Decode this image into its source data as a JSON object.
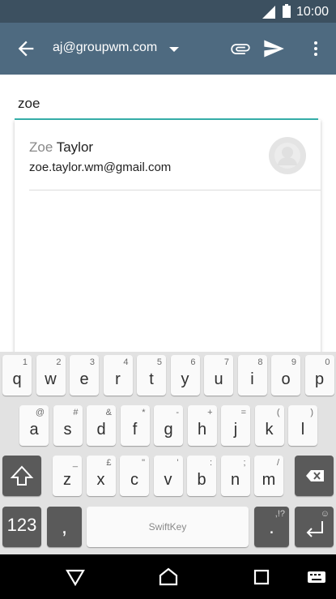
{
  "status_bar": {
    "time": "10:00"
  },
  "toolbar": {
    "account": "aj@groupwm.com"
  },
  "compose": {
    "to_value": "zoe"
  },
  "suggestion": {
    "name_match": "Zoe",
    "name_rest": " Taylor",
    "email": "zoe.taylor.wm@gmail.com"
  },
  "keyboard": {
    "row1": [
      {
        "k": "q",
        "a": "1"
      },
      {
        "k": "w",
        "a": "2"
      },
      {
        "k": "e",
        "a": "3"
      },
      {
        "k": "r",
        "a": "4"
      },
      {
        "k": "t",
        "a": "5"
      },
      {
        "k": "y",
        "a": "6"
      },
      {
        "k": "u",
        "a": "7"
      },
      {
        "k": "i",
        "a": "8"
      },
      {
        "k": "o",
        "a": "9"
      },
      {
        "k": "p",
        "a": "0"
      }
    ],
    "row2": [
      {
        "k": "a",
        "a": "@"
      },
      {
        "k": "s",
        "a": "#"
      },
      {
        "k": "d",
        "a": "&"
      },
      {
        "k": "f",
        "a": "*"
      },
      {
        "k": "g",
        "a": "-"
      },
      {
        "k": "h",
        "a": "+"
      },
      {
        "k": "j",
        "a": "="
      },
      {
        "k": "k",
        "a": "("
      },
      {
        "k": "l",
        "a": ")"
      }
    ],
    "row3": [
      {
        "k": "z",
        "a": "_"
      },
      {
        "k": "x",
        "a": "£"
      },
      {
        "k": "c",
        "a": "\""
      },
      {
        "k": "v",
        "a": "'"
      },
      {
        "k": "b",
        "a": ":"
      },
      {
        "k": "n",
        "a": ";"
      },
      {
        "k": "m",
        "a": "/"
      }
    ],
    "numbers_label": "123",
    "comma_label": ",",
    "period_label": ".",
    "period_alt": ",!?",
    "space_label": "SwiftKey",
    "enter_alt": "☺"
  }
}
